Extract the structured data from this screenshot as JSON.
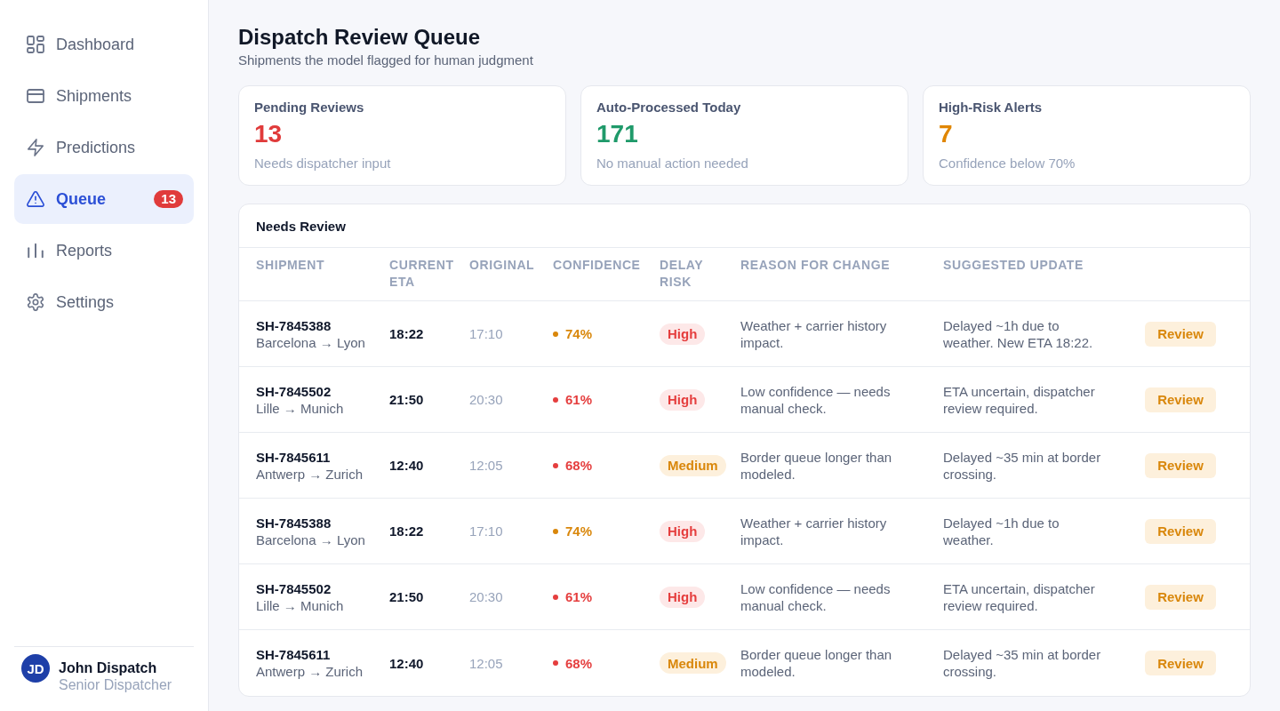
{
  "sidebar": {
    "nav": [
      {
        "label": "Dashboard",
        "selected": false
      },
      {
        "label": "Shipments",
        "selected": false
      },
      {
        "label": "Predictions",
        "selected": false
      },
      {
        "label": "Queue",
        "selected": true,
        "badge": "13"
      },
      {
        "label": "Reports",
        "selected": false
      },
      {
        "label": "Settings",
        "selected": false
      }
    ],
    "user": {
      "initials": "JD",
      "name": "John Dispatch",
      "role": "Senior Dispatcher"
    }
  },
  "page": {
    "title": "Dispatch Review Queue",
    "subtitle": "Shipments the model flagged for human judgment"
  },
  "stats": [
    {
      "label": "Pending Reviews",
      "value": "13",
      "note": "Needs dispatcher input",
      "color": "#e03b3b"
    },
    {
      "label": "Auto-Processed Today",
      "value": "171",
      "note": "No manual action needed",
      "color": "#1f9a6a"
    },
    {
      "label": "High-Risk Alerts",
      "value": "7",
      "note": "Confidence below 70%",
      "color": "#e08600"
    }
  ],
  "table": {
    "title": "Needs Review",
    "columns": [
      "SHIPMENT",
      "CURRENT ETA",
      "ORIGINAL",
      "CONFIDENCE",
      "DELAY RISK",
      "REASON FOR CHANGE",
      "SUGGESTED UPDATE"
    ],
    "rows": [
      {
        "shipment": "SH-7845388",
        "route": "Barcelona → Lyon",
        "current_eta": "18:22",
        "original_eta": "17:10",
        "confidence": {
          "value": "74%",
          "color": "#d9870b"
        },
        "risk": {
          "label": "High",
          "kind": "high"
        },
        "reason": "Weather + carrier history impact.",
        "suggestion": "Delayed ~1h due to weather. New ETA 18:22.",
        "action": "Review"
      },
      {
        "shipment": "SH-7845502",
        "route": "Lille → Munich",
        "current_eta": "21:50",
        "original_eta": "20:30",
        "confidence": {
          "value": "61%",
          "color": "#e53e3e"
        },
        "risk": {
          "label": "High",
          "kind": "high"
        },
        "reason": "Low confidence — needs manual check.",
        "suggestion": "ETA uncertain, dispatcher review required.",
        "action": "Review"
      },
      {
        "shipment": "SH-7845611",
        "route": "Antwerp → Zurich",
        "current_eta": "12:40",
        "original_eta": "12:05",
        "confidence": {
          "value": "68%",
          "color": "#e53e3e"
        },
        "risk": {
          "label": "Medium",
          "kind": "medium"
        },
        "reason": "Border queue longer than modeled.",
        "suggestion": "Delayed ~35 min at border crossing.",
        "action": "Review"
      },
      {
        "shipment": "SH-7845388",
        "route": "Barcelona → Lyon",
        "current_eta": "18:22",
        "original_eta": "17:10",
        "confidence": {
          "value": "74%",
          "color": "#d9870b"
        },
        "risk": {
          "label": "High",
          "kind": "high"
        },
        "reason": "Weather + carrier history impact.",
        "suggestion": "Delayed ~1h due to weather.",
        "action": "Review"
      },
      {
        "shipment": "SH-7845502",
        "route": "Lille → Munich",
        "current_eta": "21:50",
        "original_eta": "20:30",
        "confidence": {
          "value": "61%",
          "color": "#e53e3e"
        },
        "risk": {
          "label": "High",
          "kind": "high"
        },
        "reason": "Low confidence — needs manual check.",
        "suggestion": "ETA uncertain, dispatcher review required.",
        "action": "Review"
      },
      {
        "shipment": "SH-7845611",
        "route": "Antwerp → Zurich",
        "current_eta": "12:40",
        "original_eta": "12:05",
        "confidence": {
          "value": "68%",
          "color": "#e53e3e"
        },
        "risk": {
          "label": "Medium",
          "kind": "medium"
        },
        "reason": "Border queue longer than modeled.",
        "suggestion": "Delayed ~35 min at border crossing.",
        "action": "Review"
      }
    ]
  }
}
